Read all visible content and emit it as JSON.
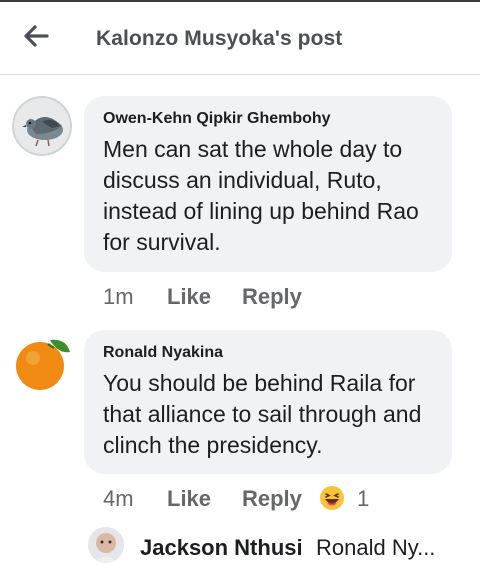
{
  "header": {
    "title": "Kalonzo Musyoka's post",
    "back_icon": "arrow-left-icon"
  },
  "comments": [
    {
      "author": "Owen-Kehn Qipkir Ghembohy",
      "text": "Men can sat the whole day to discuss an individual, Ruto, instead of lining up behind Rao for survival.",
      "time": "1m",
      "like_label": "Like",
      "reply_label": "Reply",
      "avatar": "pigeon-avatar"
    },
    {
      "author": "Ronald Nyakina",
      "text": "You should be behind Raila for that alliance to sail through and clinch the presidency.",
      "time": "4m",
      "like_label": "Like",
      "reply_label": "Reply",
      "reaction_icon": "haha-emoji-icon",
      "reaction_count": "1",
      "avatar": "orange-avatar"
    }
  ],
  "reply_preview": {
    "author": "Jackson Nthusi",
    "text": "Ronald Ny...",
    "avatar": "child-avatar"
  }
}
